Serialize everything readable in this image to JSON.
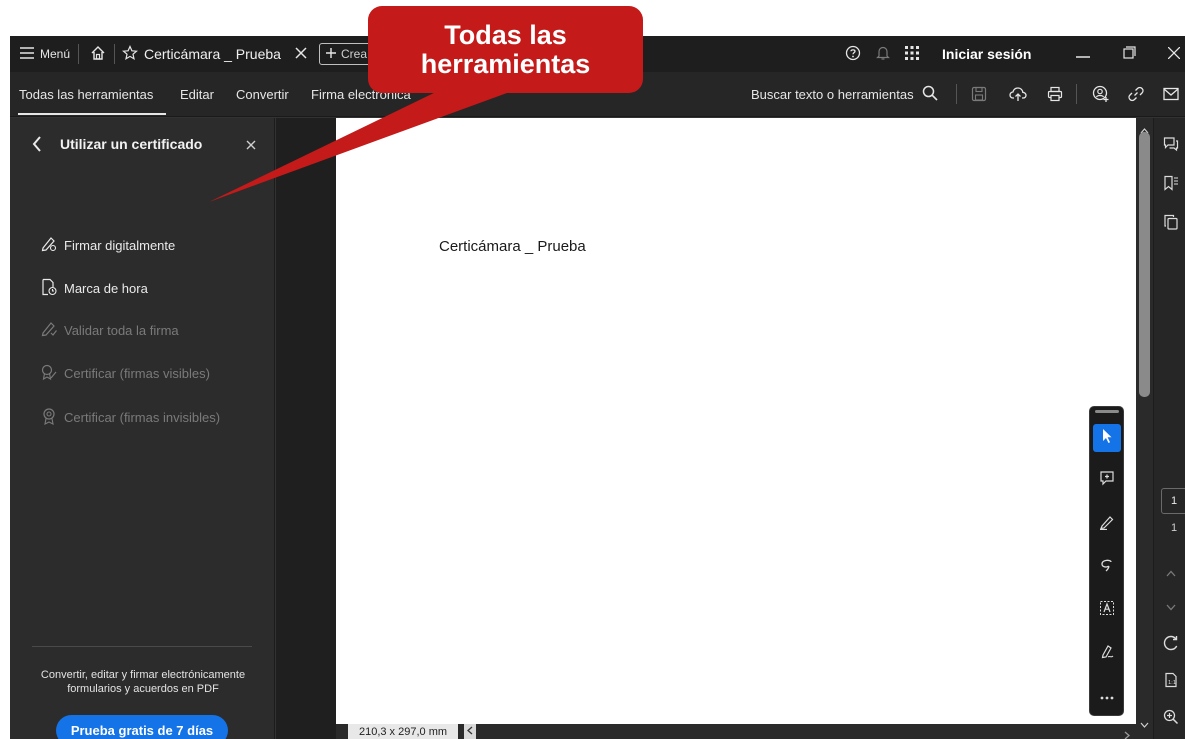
{
  "titlebar": {
    "menu_label": "Menú",
    "tab_title": "Certicámara _ Prueba",
    "new_tab_label": "Crea",
    "sign_in_label": "Iniciar sesión"
  },
  "toolbar": {
    "nav_items": [
      "Todas las herramientas",
      "Editar",
      "Convertir",
      "Firma electrónica"
    ],
    "search_label": "Buscar texto o herramientas"
  },
  "left_panel": {
    "title": "Utilizar un certificado",
    "items": [
      {
        "label": "Firmar digitalmente",
        "enabled": true,
        "icon": "pen-signature-icon"
      },
      {
        "label": "Marca de hora",
        "enabled": true,
        "icon": "doc-clock-icon"
      },
      {
        "label": "Validar toda la firma",
        "enabled": false,
        "icon": "signature-check-icon"
      },
      {
        "label": "Certificar (firmas visibles)",
        "enabled": false,
        "icon": "certificate-visible-icon"
      },
      {
        "label": "Certificar (firmas invisibles)",
        "enabled": false,
        "icon": "certificate-invisible-icon"
      }
    ],
    "promo_line1": "Convertir, editar y firmar electrónicamente",
    "promo_line2": "formularios y acuerdos en PDF",
    "trial_button": "Prueba gratis de 7 días"
  },
  "document": {
    "text": "Certicámara _ Prueba",
    "page_size": "210,3 x 297,0 mm"
  },
  "page_nav": {
    "current": "1",
    "total": "1"
  },
  "callout": {
    "line1": "Todas las",
    "line2": "herramientas"
  },
  "colors": {
    "accent": "#1473e6",
    "callout": "#c41a1a",
    "panel_bg": "#2c2c2c",
    "titlebar_bg": "#1e1e1e"
  }
}
